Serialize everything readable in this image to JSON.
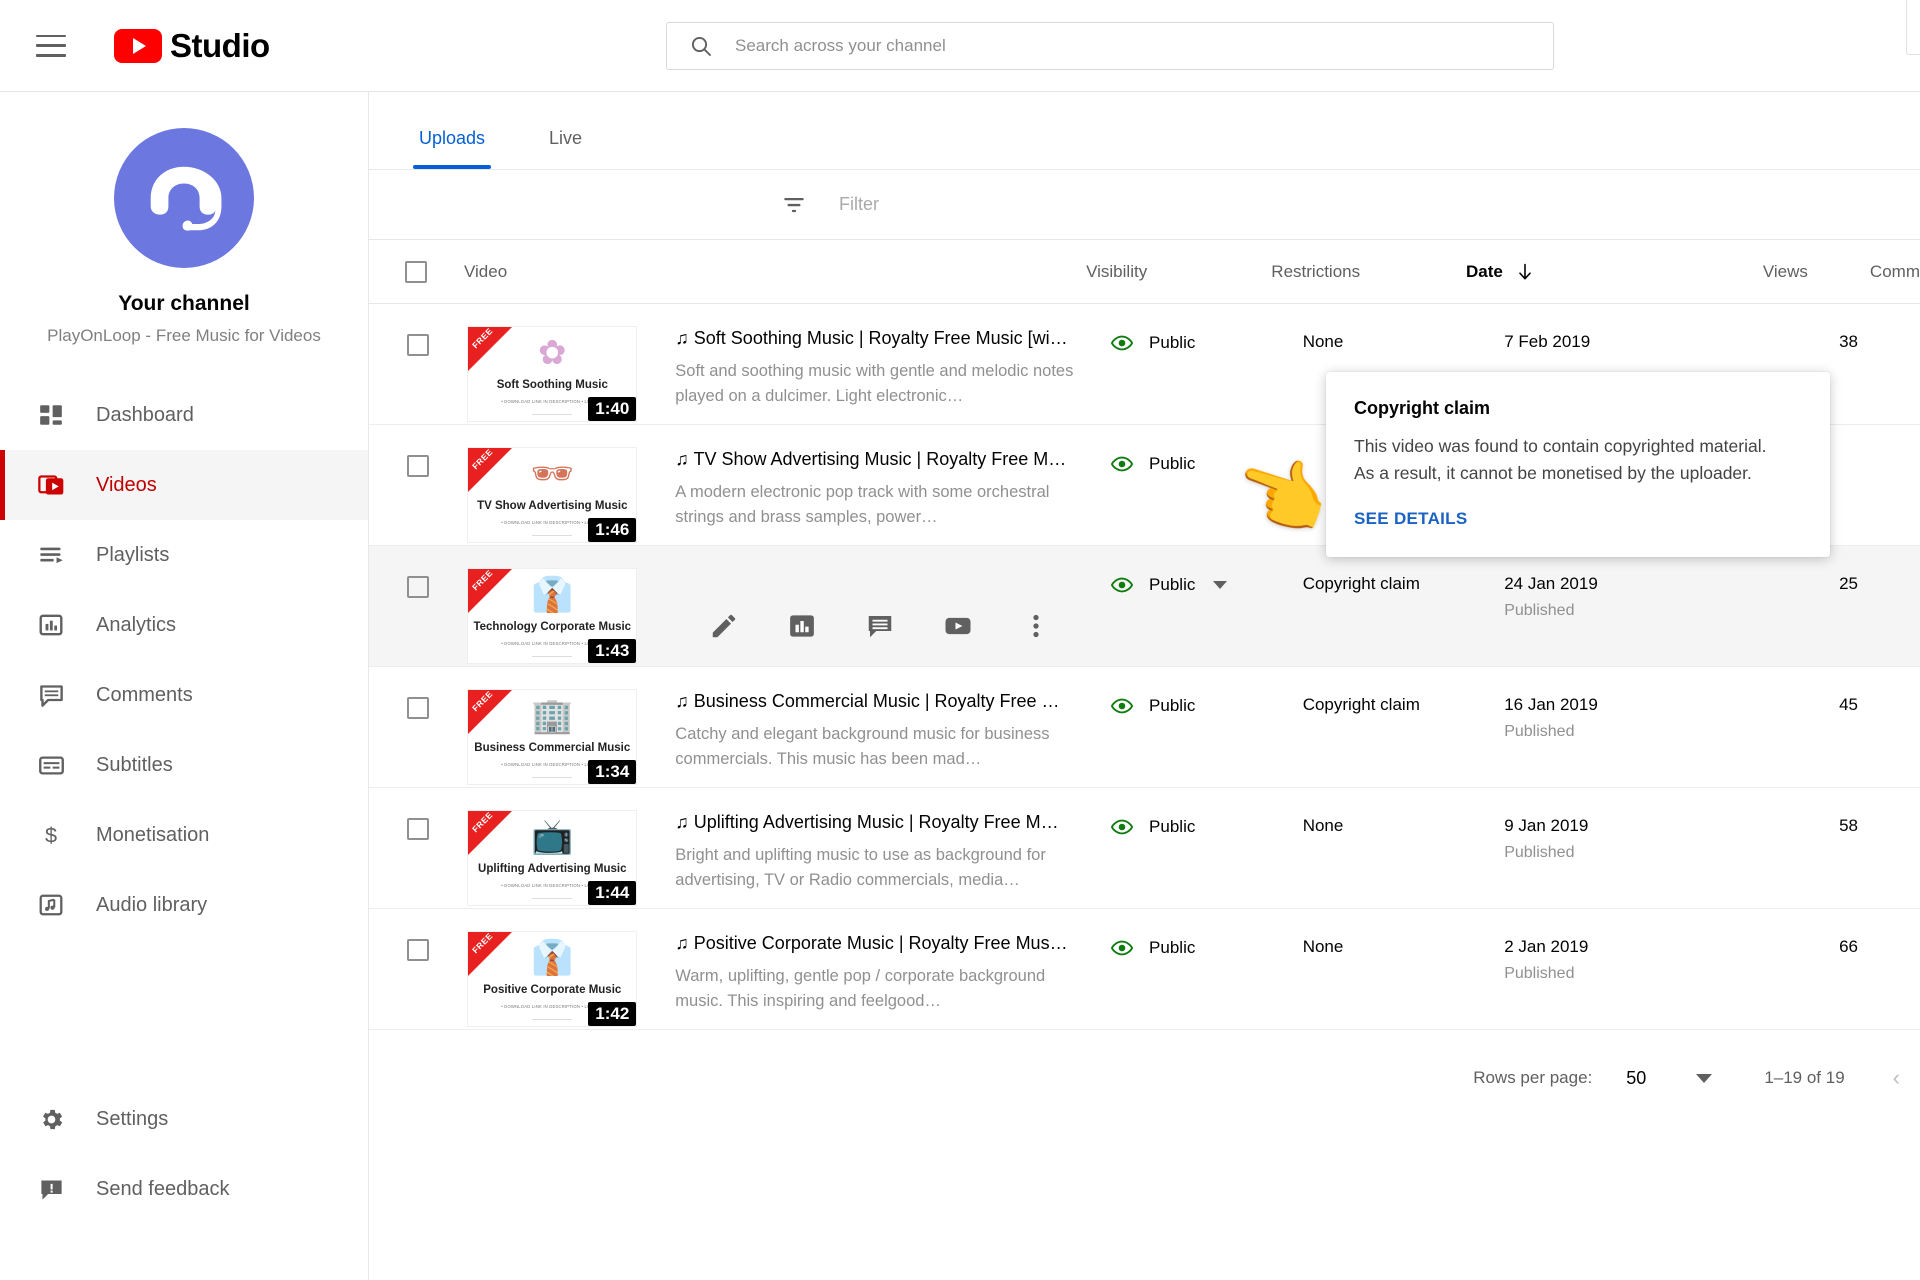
{
  "header": {
    "menu_icon": "hamburger-icon",
    "logo_text": "Studio",
    "search": {
      "icon": "search-icon",
      "placeholder": "Search across your channel",
      "value": ""
    }
  },
  "sidebar": {
    "channel": {
      "avatar_icon": "headphones-smiley-avatar",
      "title": "Your channel",
      "subtitle": "PlayOnLoop - Free Music for Videos"
    },
    "items": [
      {
        "label": "Dashboard",
        "icon": "dashboard-icon",
        "active": false
      },
      {
        "label": "Videos",
        "icon": "videos-icon",
        "active": true
      },
      {
        "label": "Playlists",
        "icon": "playlists-icon",
        "active": false
      },
      {
        "label": "Analytics",
        "icon": "analytics-icon",
        "active": false
      },
      {
        "label": "Comments",
        "icon": "comments-icon",
        "active": false
      },
      {
        "label": "Subtitles",
        "icon": "subtitles-icon",
        "active": false
      },
      {
        "label": "Monetisation",
        "icon": "dollar-icon",
        "active": false
      },
      {
        "label": "Audio library",
        "icon": "audio-library-icon",
        "active": false
      }
    ],
    "bottom_items": [
      {
        "label": "Settings",
        "icon": "gear-icon"
      },
      {
        "label": "Send feedback",
        "icon": "feedback-icon"
      }
    ]
  },
  "main": {
    "tabs": [
      {
        "label": "Uploads",
        "active": true
      },
      {
        "label": "Live",
        "active": false
      }
    ],
    "filter": {
      "icon": "filter-icon",
      "placeholder": "Filter"
    },
    "columns": {
      "video": "Video",
      "visibility": "Visibility",
      "restrictions": "Restrictions",
      "date": "Date",
      "date_sort_icon": "arrow-down-icon",
      "views": "Views",
      "comments": "Comm"
    },
    "rows": [
      {
        "thumb": {
          "ribbon": "FREE",
          "emoji": "✿",
          "title": "Soft Soothing Music",
          "sub": "• DOWNLOAD LINK IN DESCRIPTION • LONGER",
          "duration": "1:40",
          "emoji_color": "#d9a8d4"
        },
        "title": "♫ Soft Soothing Music | Royalty Free Music [wi…",
        "description": "Soft and soothing music with gentle and melodic notes played on a dulcimer. Light electronic…",
        "visibility": "Public",
        "restrictions": "None",
        "date": "7 Feb 2019",
        "status": "",
        "views": "38",
        "hovered": false
      },
      {
        "thumb": {
          "ribbon": "FREE",
          "emoji": "🕶",
          "title": "TV Show Advertising Music",
          "sub": "• DOWNLOAD LINK IN DESCRIPTION • LONGER",
          "duration": "1:46",
          "emoji_color": "#d4745a"
        },
        "title": "♫ TV Show Advertising Music | Royalty Free M…",
        "description": "A modern electronic pop track with some orchestral strings and brass samples, power…",
        "visibility": "Public",
        "restrictions": "",
        "date": "",
        "status": "",
        "views": "",
        "hovered": false
      },
      {
        "thumb": {
          "ribbon": "FREE",
          "emoji": "👔",
          "title": "Technology Corporate Music",
          "sub": "• DOWNLOAD LINK IN DESCRIPTION • LONGER",
          "duration": "1:43",
          "emoji_color": "#4a89c9"
        },
        "title": "",
        "description": "",
        "visibility": "Public",
        "restrictions": "Copyright claim",
        "date": "24 Jan 2019",
        "status": "Published",
        "views": "25",
        "hovered": true,
        "actions": [
          {
            "icon": "pencil-icon",
            "label": "Edit"
          },
          {
            "icon": "analytics-bar-icon",
            "label": "Analytics"
          },
          {
            "icon": "comment-icon",
            "label": "Comments"
          },
          {
            "icon": "youtube-play-icon",
            "label": "View on YouTube"
          },
          {
            "icon": "more-vertical-icon",
            "label": "Options"
          }
        ]
      },
      {
        "thumb": {
          "ribbon": "FREE",
          "emoji": "🏢",
          "title": "Business Commercial Music",
          "sub": "• DOWNLOAD LINK IN DESCRIPTION • LONGER",
          "duration": "1:34",
          "emoji_color": "#5b6bc0"
        },
        "title": "♫ Business Commercial Music | Royalty Free …",
        "description": "Catchy and elegant background music for business commercials. This music has been mad…",
        "visibility": "Public",
        "restrictions": "Copyright claim",
        "date": "16 Jan 2019",
        "status": "Published",
        "views": "45",
        "hovered": false
      },
      {
        "thumb": {
          "ribbon": "FREE",
          "emoji": "📺",
          "title": "Uplifting Advertising Music",
          "sub": "• DOWNLOAD LINK IN DESCRIPTION • LONGER",
          "duration": "1:44",
          "emoji_color": "#6cc5d9"
        },
        "title": "♫ Uplifting Advertising Music | Royalty Free M…",
        "description": "Bright and uplifting music to use as background for advertising, TV or Radio commercials, media…",
        "visibility": "Public",
        "restrictions": "None",
        "date": "9 Jan 2019",
        "status": "Published",
        "views": "58",
        "hovered": false
      },
      {
        "thumb": {
          "ribbon": "FREE",
          "emoji": "👔",
          "title": "Positive Corporate Music",
          "sub": "• DOWNLOAD LINK IN DESCRIPTION • LONGER",
          "duration": "1:42",
          "emoji_color": "#e0a93f"
        },
        "title": "♫ Positive Corporate Music | Royalty Free Mus…",
        "description": "Warm, uplifting, gentle pop / corporate background music. This inspiring and feelgood…",
        "visibility": "Public",
        "restrictions": "None",
        "date": "2 Jan 2019",
        "status": "Published",
        "views": "66",
        "hovered": false
      }
    ],
    "pagination": {
      "rows_per_page_label": "Rows per page:",
      "rows_per_page_value": "50",
      "range": "1–19 of 19",
      "prev_arrow": "‹"
    }
  },
  "tooltip": {
    "title": "Copyright claim",
    "line1": "This video was found to contain copyrighted material.",
    "line2": "As a result, it cannot be monetised by the uploader.",
    "link": "SEE DETAILS"
  },
  "cursor": {
    "icon": "pointing-hand-cursor",
    "glyph": "👈"
  },
  "colors": {
    "brand_red": "#ff0000",
    "accent_blue": "#065fd4",
    "public_green": "#107c10",
    "active_nav": "#cc0000",
    "avatar_purple": "#6c77e0"
  }
}
